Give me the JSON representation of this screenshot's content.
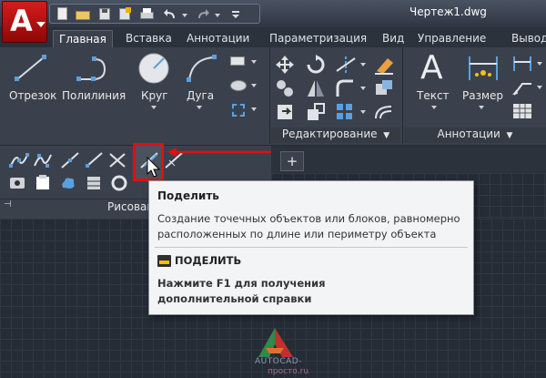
{
  "window": {
    "document_title": "Чертеж1.dwg"
  },
  "tabs": [
    {
      "label": "Главная",
      "active": true
    },
    {
      "label": "Вставка"
    },
    {
      "label": "Аннотации"
    },
    {
      "label": "Параметризация"
    },
    {
      "label": "Вид"
    },
    {
      "label": "Управление"
    },
    {
      "label": "Вывод"
    }
  ],
  "ribbon": {
    "tools": {
      "line": "Отрезок",
      "polyline": "Полилиния",
      "circle": "Круг",
      "arc": "Дуга",
      "text": "Текст",
      "dimension": "Размер"
    },
    "panels": {
      "draw": "Рисование",
      "modify": "Редактирование",
      "annotation": "Аннотации"
    }
  },
  "file_tabs": {
    "new_tab": "+"
  },
  "tooltip": {
    "title": "Поделить",
    "description": "Создание точечных объектов или блоков, равномерно расположенных по длине или периметру объекта",
    "command": "ПОДЕЛИТЬ",
    "help": "Нажмите F1 для получения дополнительной справки"
  },
  "watermark": {
    "line1": "AUTOCAD-",
    "line2": "просто.ru"
  },
  "colors": {
    "accent_red": "#e01010",
    "app_button": "#c0141a",
    "ribbon_bg": "#3b414c",
    "canvas_bg": "#262c35"
  }
}
